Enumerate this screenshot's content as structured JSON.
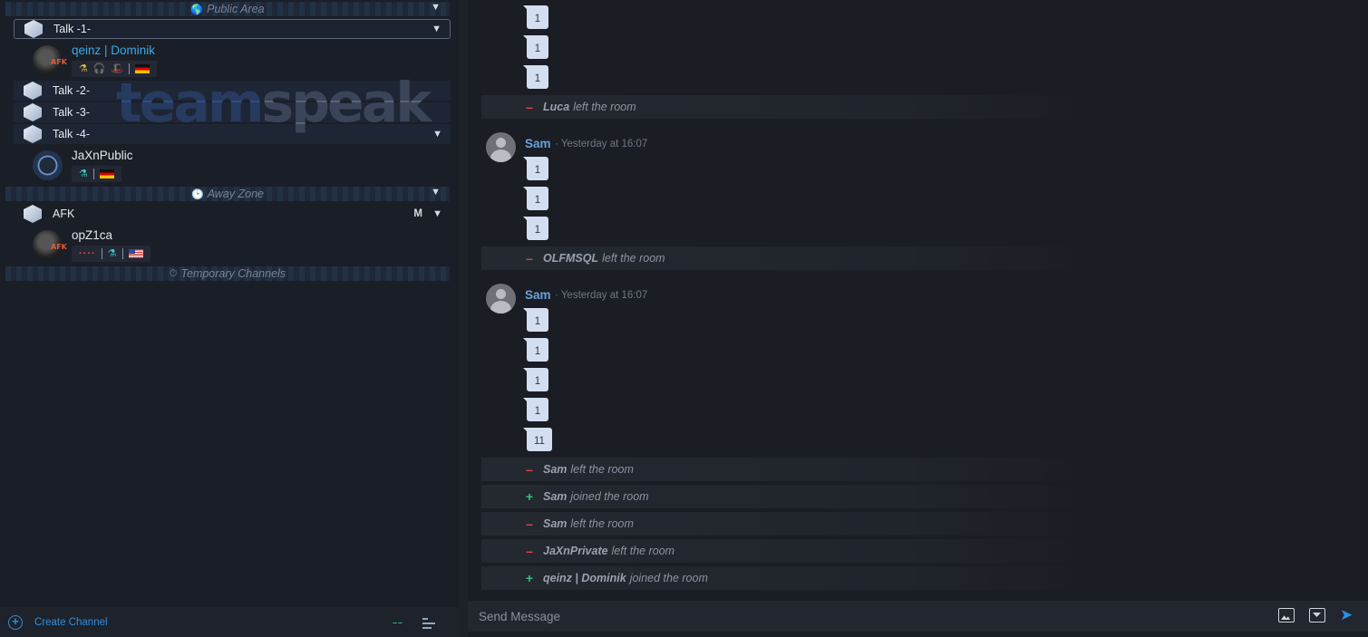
{
  "sidebar": {
    "logo": {
      "part_a": "team",
      "part_b": "speak"
    },
    "spacers": [
      {
        "label": "Public Area",
        "icon": "🌎"
      },
      {
        "label": "Away Zone",
        "icon": "🕑"
      },
      {
        "label": "Temporary Channels",
        "icon": "⏱"
      }
    ],
    "channels": [
      {
        "name": "Talk -1-"
      },
      {
        "name": "Talk -2-"
      },
      {
        "name": "Talk -3-"
      },
      {
        "name": "Talk -4-"
      },
      {
        "name": "AFK",
        "flag": "M"
      }
    ],
    "clients": [
      {
        "name": "qeinz | Dominik",
        "status": "AFK"
      },
      {
        "name": "JaXnPublic"
      },
      {
        "name": "opZ1ca",
        "status": "AFK"
      }
    ],
    "create_channel": "Create Channel"
  },
  "chat": {
    "messages_top": [
      "1",
      "1",
      "1"
    ],
    "event1": {
      "who": "Luca",
      "action": "left the room"
    },
    "group1": {
      "author": "Sam",
      "time": "· Yesterday at 16:07",
      "messages": [
        "1",
        "1",
        "1"
      ]
    },
    "event2": {
      "who": "OLFMSQL",
      "action": "left the room"
    },
    "group2": {
      "author": "Sam",
      "time": "· Yesterday at 16:07",
      "messages": [
        "1",
        "1",
        "1",
        "1",
        "11"
      ]
    },
    "events": [
      {
        "who": "Sam",
        "action": "left the room",
        "type": "minus"
      },
      {
        "who": "Sam",
        "action": "joined the room",
        "type": "plus"
      },
      {
        "who": "Sam",
        "action": "left the room",
        "type": "minus"
      },
      {
        "who": "JaXnPrivate",
        "action": "left the room",
        "type": "minus"
      },
      {
        "who": "qeinz | Dominik",
        "action": "joined the room",
        "type": "plus"
      }
    ],
    "composer_placeholder": "Send Message"
  },
  "colors": {
    "accent": "#2c8fe0",
    "self_name": "#39a9e6",
    "join": "#35c27c",
    "leave": "#e0443a"
  }
}
